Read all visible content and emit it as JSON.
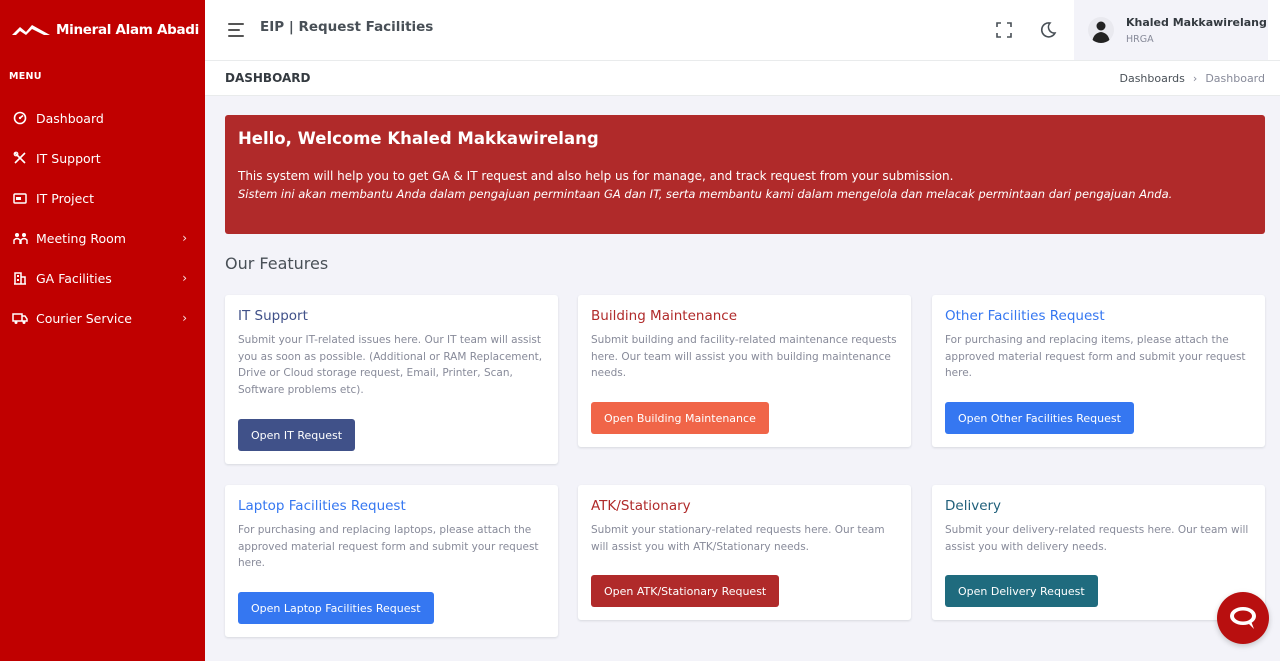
{
  "brand": {
    "name": "Mineral Alam Abadi"
  },
  "sidebar": {
    "menu_title": "MENU",
    "items": [
      {
        "label": "Dashboard",
        "icon": "dashboard-icon",
        "has_children": false
      },
      {
        "label": "IT Support",
        "icon": "tools-icon",
        "has_children": false
      },
      {
        "label": "IT Project",
        "icon": "project-icon",
        "has_children": false
      },
      {
        "label": "Meeting Room",
        "icon": "group-icon",
        "has_children": true
      },
      {
        "label": "GA Facilities",
        "icon": "building-icon",
        "has_children": true
      },
      {
        "label": "Courier Service",
        "icon": "truck-icon",
        "has_children": true
      }
    ]
  },
  "topbar": {
    "app_title": "EIP | Request Facilities",
    "user": {
      "name": "Khaled Makkawirelang",
      "role": "HRGA"
    }
  },
  "page": {
    "title": "DASHBOARD",
    "breadcrumb": [
      "Dashboards",
      "Dashboard"
    ]
  },
  "banner": {
    "title": "Hello, Welcome Khaled Makkawirelang",
    "text_en": "This system will help you to get GA & IT request and also help us for manage, and track request from your submission.",
    "text_id": "Sistem ini akan membantu Anda dalam pengajuan permintaan GA dan IT, serta membantu kami dalam mengelola dan melacak permintaan dari pengajuan Anda."
  },
  "features": {
    "title": "Our Features",
    "cards": [
      {
        "title": "IT Support",
        "text": "Submit your IT-related issues here. Our IT team will assist you as soon as possible. (Additional or RAM Replacement, Drive or Cloud storage request, Email, Printer, Scan, Software problems etc).",
        "button": "Open IT Request",
        "title_color": "#405189",
        "button_color": "#405189"
      },
      {
        "title": "Building Maintenance",
        "text": "Submit building and facility-related maintenance requests here. Our team will assist you with building maintenance needs.",
        "button": "Open Building Maintenance",
        "title_color": "#b02a2a",
        "button_color": "#f06548"
      },
      {
        "title": "Other Facilities Request",
        "text": "For purchasing and replacing items, please attach the approved material request form and submit your request here.",
        "button": "Open Other Facilities Request",
        "title_color": "#3577f1",
        "button_color": "#3577f1"
      },
      {
        "title": "Laptop Facilities Request",
        "text": "For purchasing and replacing laptops, please attach the approved material request form and submit your request here.",
        "button": "Open Laptop Facilities Request",
        "title_color": "#3577f1",
        "button_color": "#3577f1"
      },
      {
        "title": "ATK/Stationary",
        "text": "Submit your stationary-related requests here. Our team will assist you with ATK/Stationary needs.",
        "button": "Open ATK/Stationary Request",
        "title_color": "#b02a2a",
        "button_color": "#b02a2a"
      },
      {
        "title": "Delivery",
        "text": "Submit your delivery-related requests here. Our team will assist you with delivery needs.",
        "button": "Open Delivery Request",
        "title_color": "#1f5f7a",
        "button_color": "#1f6b7e"
      }
    ]
  },
  "colors": {
    "sidebar_bg": "#c00000",
    "banner_bg": "#b02a2a",
    "page_bg": "#f3f3f9"
  }
}
